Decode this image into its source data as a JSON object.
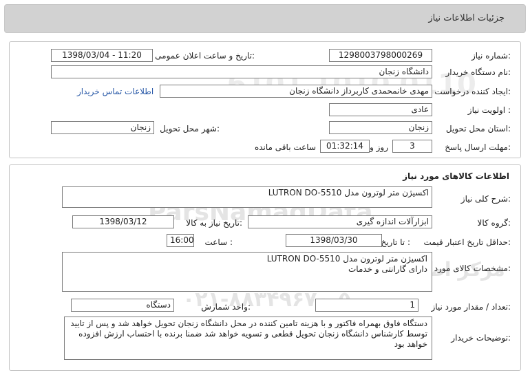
{
  "header": {
    "title": "جزئیات اطلاعات نیاز"
  },
  "need_info": {
    "need_number": {
      "label": "شماره نیاز:",
      "value": "1298003798000269"
    },
    "announce_datetime": {
      "label": "تاریخ و ساعت اعلان عمومی:",
      "value": "1398/03/04 - 11:20"
    },
    "buyer_org": {
      "label": "نام دستگاه خریدار:",
      "value": "دانشگاه زنجان"
    },
    "requester": {
      "label": "ایجاد کننده درخواست:",
      "value": "مهدی خانمحمدی کاربرداز دانشگاه زنجان"
    },
    "contact_link": "اطلاعات تماس خریدار",
    "priority": {
      "label": "اولویت نیاز :",
      "value": "عادی"
    },
    "province": {
      "label": "استان محل تحویل:",
      "value": "زنجان"
    },
    "city": {
      "label": "شهر محل تحویل:",
      "value": "زنجان"
    },
    "deadline": {
      "label": "مهلت ارسال پاسخ:",
      "days": "3",
      "days_unit": "روز و",
      "time": "01:32:14",
      "remaining_text": "ساعت باقی مانده"
    }
  },
  "goods": {
    "title": "اطلاعات کالاهای مورد نیاز",
    "summary": {
      "label": "شرح کلی نیاز:",
      "value": "اکسیژن متر لوترون مدل LUTRON DO-5510"
    },
    "group": {
      "label": "گروه کالا:",
      "value": "ابزارآلات اندازه گیری"
    },
    "need_date": {
      "label": "تاریخ نیاز به کالا:",
      "value": "1398/03/12"
    },
    "price_validity": {
      "label": "حداقل تاریخ اعتبار قیمت:",
      "to_date_label": "تا تاریخ :",
      "date": "1398/03/30",
      "time_label": "ساعت :",
      "time": "16:00"
    },
    "specs": {
      "label": "مشخصات کالای مورد نیاز:",
      "line1": "اکسیژن متر لوترون مدل  LUTRON DO-5510",
      "line2": "دارای گارانتی و خدمات"
    },
    "quantity": {
      "label": "تعداد / مقدار مورد نیاز:",
      "value": "1"
    },
    "unit": {
      "label": "واحد شمارش:",
      "value": "دستگاه"
    },
    "buyer_notes": {
      "label": "توضیحات خریدار:",
      "text": "دستگاه فاوق بهمراه فاکتور و با هزینه تامین کننده در محل دانشگاه زنجان تحویل خواهد شد و پس از تایید توسط کارشناس دانشگاه زنجان تحویل قطعی و تسویه خواهد شد ضمنا برنده با احتساب ارزش افزوده خواهد بود"
    }
  },
  "watermark": {
    "brand": "ParsNamadData",
    "line1": "مرکز اطلاع رسانی مناقصه و مزایده",
    "phone": "۰۲۱-۸۸۳۴۹۶۷۰-۵",
    "digits": "6101 1010 0110"
  }
}
